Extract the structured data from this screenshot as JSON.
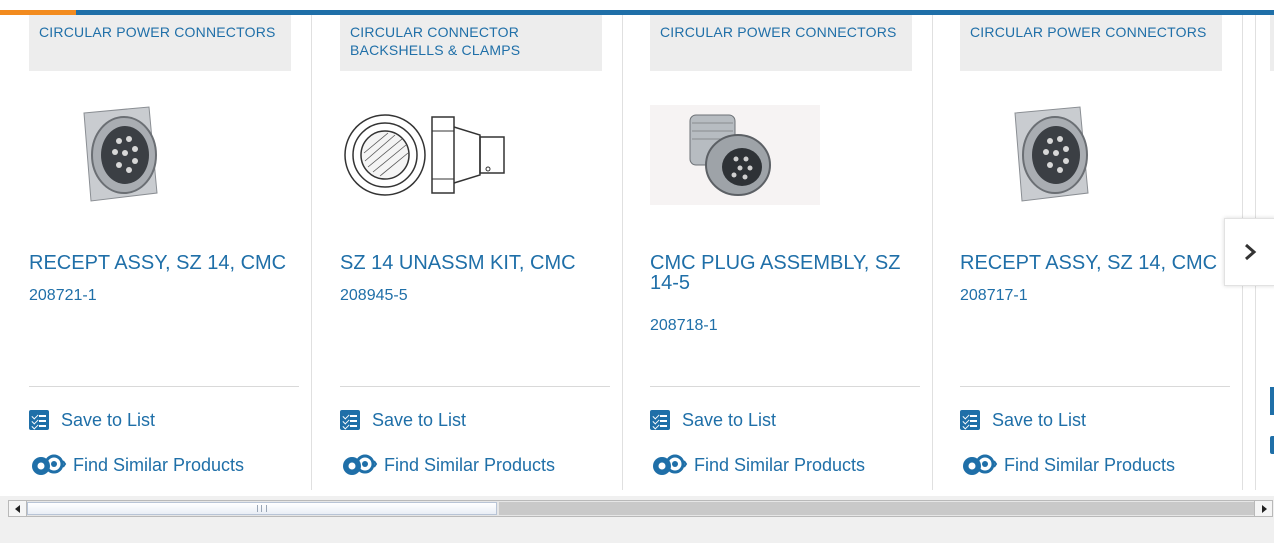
{
  "colors": {
    "link": "#1f6fa8",
    "accent": "#f28b1f",
    "category_bg": "#ededed"
  },
  "products": [
    {
      "category": "CIRCULAR POWER CONNECTORS",
      "title": "RECEPT ASSY, SZ 14, CMC",
      "part_number": "208721-1",
      "save_label": "Save to List",
      "similar_label": "Find Similar Products",
      "image": "square-flange-receptacle"
    },
    {
      "category": "CIRCULAR CONNECTOR BACKSHELLS & CLAMPS",
      "title": "SZ 14 UNASSM KIT, CMC",
      "part_number": "208945-5",
      "save_label": "Save to List",
      "similar_label": "Find Similar Products",
      "image": "backshell-drawing"
    },
    {
      "category": "CIRCULAR POWER CONNECTORS",
      "title": "CMC PLUG ASSEMBLY, SZ 14-5",
      "part_number": "208718-1",
      "save_label": "Save to List",
      "similar_label": "Find Similar Products",
      "image": "plug-assembly"
    },
    {
      "category": "CIRCULAR POWER CONNECTORS",
      "title": "RECEPT ASSY, SZ 14, CMC",
      "part_number": "208717-1",
      "save_label": "Save to List",
      "similar_label": "Find Similar Products",
      "image": "square-flange-receptacle"
    }
  ],
  "carousel": {
    "next_icon": "chevron-right-icon"
  },
  "scrollbar": {
    "left_icon": "scroll-left-arrow-icon",
    "right_icon": "scroll-right-arrow-icon"
  }
}
